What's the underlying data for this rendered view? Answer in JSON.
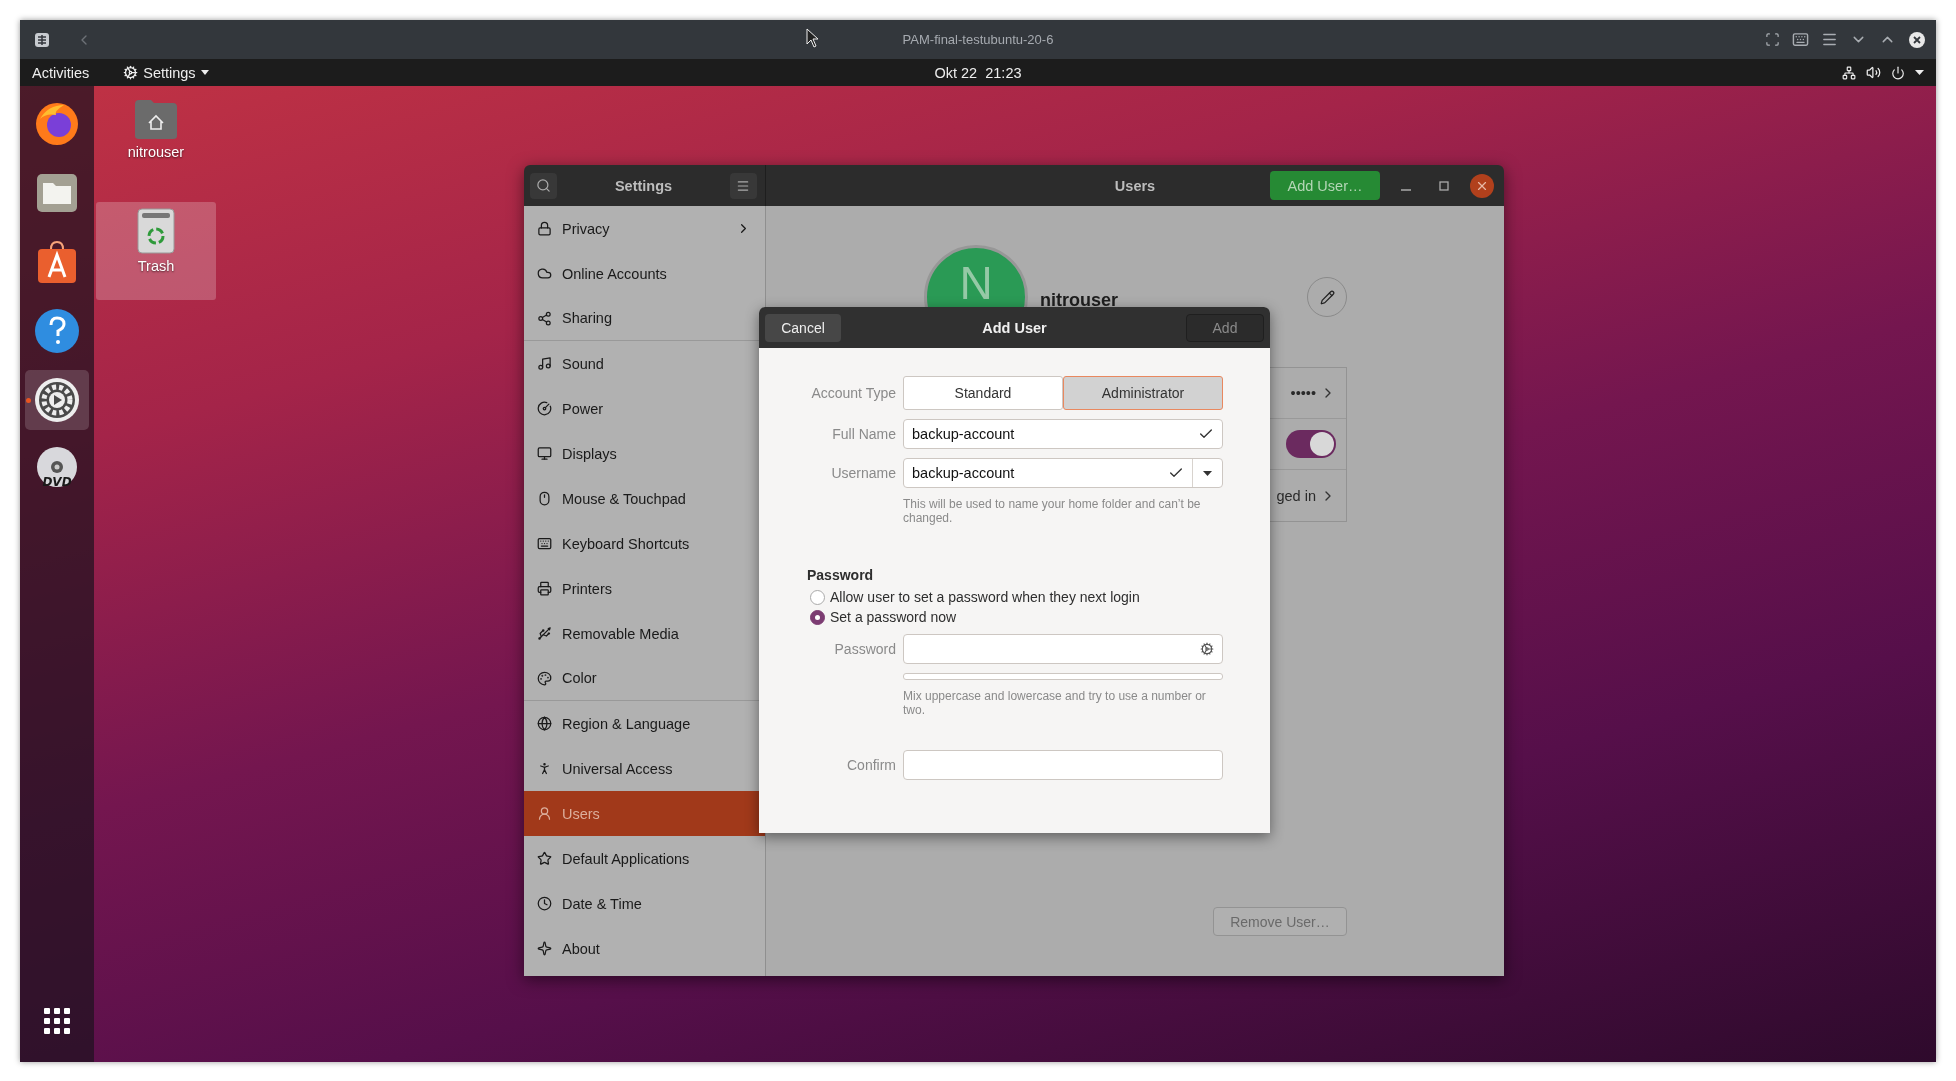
{
  "vm_window": {
    "title": "PAM-final-testubuntu-20-6"
  },
  "top_panel": {
    "activities": "Activities",
    "app_menu": "Settings",
    "clock": "Okt 22  21:23"
  },
  "dock": [
    {
      "kind": "browser",
      "running": false
    },
    {
      "kind": "files",
      "running": false
    },
    {
      "kind": "store",
      "running": false
    },
    {
      "kind": "help",
      "running": false
    },
    {
      "kind": "settings",
      "running": true
    },
    {
      "kind": "dvd",
      "running": false,
      "label": "DVD"
    }
  ],
  "desktop_icons": [
    {
      "kind": "folder",
      "label": "nitrouser",
      "selected": false
    },
    {
      "kind": "trash",
      "label": "Trash",
      "selected": true
    }
  ],
  "settings": {
    "sidebar_title": "Settings",
    "panel_title": "Users",
    "add_user_button": "Add User…",
    "sidebar": [
      {
        "label": "Privacy",
        "selected": false,
        "submenu": true,
        "separator_after": false
      },
      {
        "label": "Online Accounts",
        "selected": false,
        "submenu": false,
        "separator_after": false
      },
      {
        "label": "Sharing",
        "selected": false,
        "submenu": false,
        "separator_after": true
      },
      {
        "label": "Sound",
        "selected": false,
        "submenu": false,
        "separator_after": false
      },
      {
        "label": "Power",
        "selected": false,
        "submenu": false,
        "separator_after": false
      },
      {
        "label": "Displays",
        "selected": false,
        "submenu": false,
        "separator_after": false
      },
      {
        "label": "Mouse & Touchpad",
        "selected": false,
        "submenu": false,
        "separator_after": false
      },
      {
        "label": "Keyboard Shortcuts",
        "selected": false,
        "submenu": false,
        "separator_after": false
      },
      {
        "label": "Printers",
        "selected": false,
        "submenu": false,
        "separator_after": false
      },
      {
        "label": "Removable Media",
        "selected": false,
        "submenu": false,
        "separator_after": false
      },
      {
        "label": "Color",
        "selected": false,
        "submenu": false,
        "separator_after": true
      },
      {
        "label": "Region & Language",
        "selected": false,
        "submenu": false,
        "separator_after": false
      },
      {
        "label": "Universal Access",
        "selected": false,
        "submenu": false,
        "separator_after": false
      },
      {
        "label": "Users",
        "selected": true,
        "submenu": false,
        "separator_after": false
      },
      {
        "label": "Default Applications",
        "selected": false,
        "submenu": false,
        "separator_after": false
      },
      {
        "label": "Date & Time",
        "selected": false,
        "submenu": false,
        "separator_after": false
      },
      {
        "label": "About",
        "selected": false,
        "submenu": false,
        "separator_after": false
      }
    ],
    "user": {
      "avatar_initial": "N",
      "name": "nitrouser"
    },
    "account_rows": [
      {
        "kind": "value",
        "text": "•••••"
      },
      {
        "kind": "toggle",
        "on": true
      },
      {
        "kind": "value",
        "text": "ged in"
      }
    ],
    "remove_button": "Remove User…"
  },
  "dialog": {
    "title": "Add User",
    "cancel": "Cancel",
    "add": {
      "label": "Add",
      "disabled": true
    },
    "account_type": {
      "label": "Account Type",
      "options": [
        {
          "label": "Standard",
          "selected": false
        },
        {
          "label": "Administrator",
          "selected": true
        }
      ]
    },
    "full_name": {
      "label": "Full Name",
      "value": "backup-account",
      "valid": true
    },
    "username": {
      "label": "Username",
      "value": "backup-account",
      "valid": true,
      "hint": "This will be used to name your home folder and can’t be changed."
    },
    "password_heading": "Password",
    "password_options": [
      {
        "label": "Allow user to set a password when they next login",
        "selected": false
      },
      {
        "label": "Set a password now",
        "selected": true
      }
    ],
    "password": {
      "label": "Password",
      "level": 0,
      "hint": "Mix uppercase and lowercase and try to use a number or two."
    },
    "confirm": {
      "label": "Confirm"
    }
  }
}
